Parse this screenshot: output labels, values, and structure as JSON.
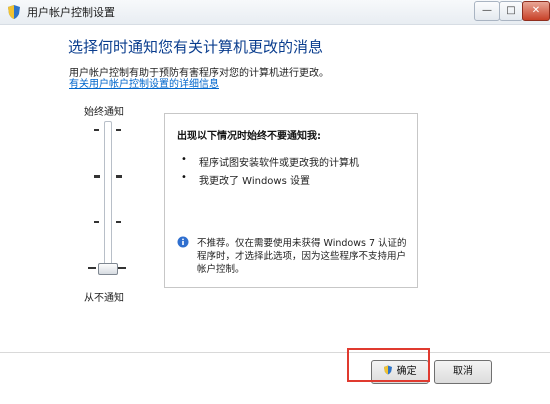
{
  "window": {
    "title": "用户帐户控制设置",
    "icon": "shield-icon",
    "controls": {
      "minimize": "—",
      "maximize": "□",
      "close": "✕"
    }
  },
  "content": {
    "heading": "选择何时通知您有关计算机更改的消息",
    "description": "用户帐户控制有助于预防有害程序对您的计算机进行更改。",
    "help_link": "有关用户帐户控制设置的详细信息"
  },
  "slider": {
    "top_label": "始终通知",
    "bottom_label": "从不通知",
    "level": 0
  },
  "info_panel": {
    "title": "出现以下情况时始终不要通知我:",
    "items": [
      "程序试图安装软件或更改我的计算机",
      "我更改了 Windows 设置"
    ],
    "note": "不推荐。仅在需要使用未获得 Windows 7 认证的程序时，才选择此选项，因为这些程序不支持用户帐户控制。",
    "note_icon": "info-icon"
  },
  "buttons": {
    "ok": "确定",
    "cancel": "取消",
    "ok_icon": "shield-icon"
  },
  "colors": {
    "heading": "#0a3d8e",
    "link": "#0066cc",
    "highlight": "#e03a2f"
  }
}
